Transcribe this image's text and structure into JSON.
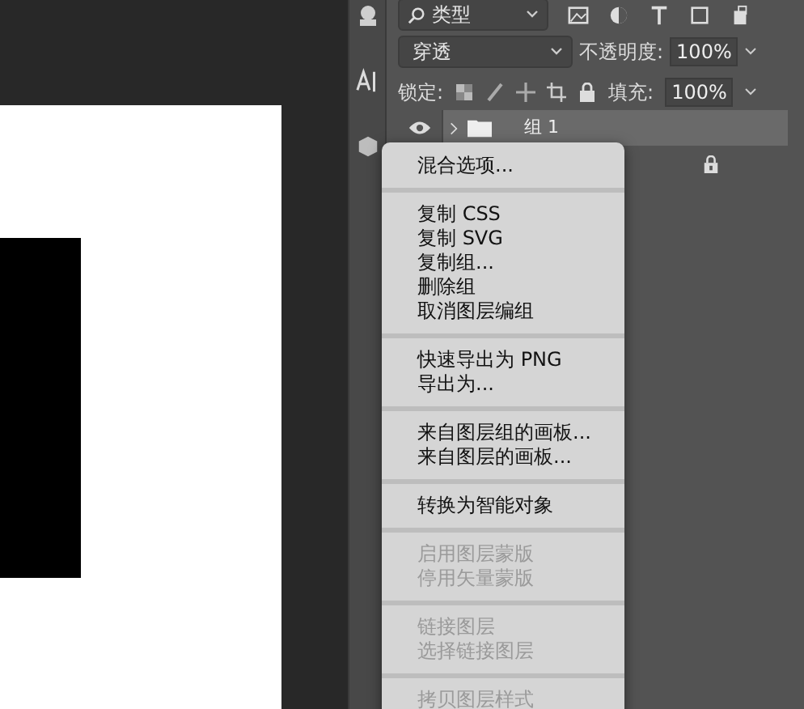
{
  "filter_bar": {
    "filter_kind": "类型"
  },
  "options_bar": {
    "blend_mode": "穿透",
    "opacity_label": "不透明度:",
    "opacity": "100%"
  },
  "lock_bar": {
    "lock_label": "锁定:",
    "fill_label": "填充:",
    "fill": "100%"
  },
  "layers": [
    {
      "name": "组 1",
      "selected": true,
      "visible": true,
      "locked": false
    },
    {
      "selected": false,
      "locked": true
    }
  ],
  "context_menu": {
    "groups": [
      [
        {
          "label": "混合选项...",
          "disabled": false
        }
      ],
      [
        {
          "label": "复制 CSS",
          "disabled": false
        },
        {
          "label": "复制 SVG",
          "disabled": false
        },
        {
          "label": "复制组...",
          "disabled": false
        },
        {
          "label": "删除组",
          "disabled": false
        },
        {
          "label": "取消图层编组",
          "disabled": false
        }
      ],
      [
        {
          "label": "快速导出为 PNG",
          "disabled": false
        },
        {
          "label": "导出为...",
          "disabled": false
        }
      ],
      [
        {
          "label": "来自图层组的画板...",
          "disabled": false
        },
        {
          "label": "来自图层的画板...",
          "disabled": false
        }
      ],
      [
        {
          "label": "转换为智能对象",
          "disabled": false
        }
      ],
      [
        {
          "label": "启用图层蒙版",
          "disabled": true
        },
        {
          "label": "停用矢量蒙版",
          "disabled": true
        }
      ],
      [
        {
          "label": "链接图层",
          "disabled": true
        },
        {
          "label": "选择链接图层",
          "disabled": true
        }
      ],
      [
        {
          "label": "拷贝图层样式",
          "disabled": true
        }
      ]
    ]
  }
}
